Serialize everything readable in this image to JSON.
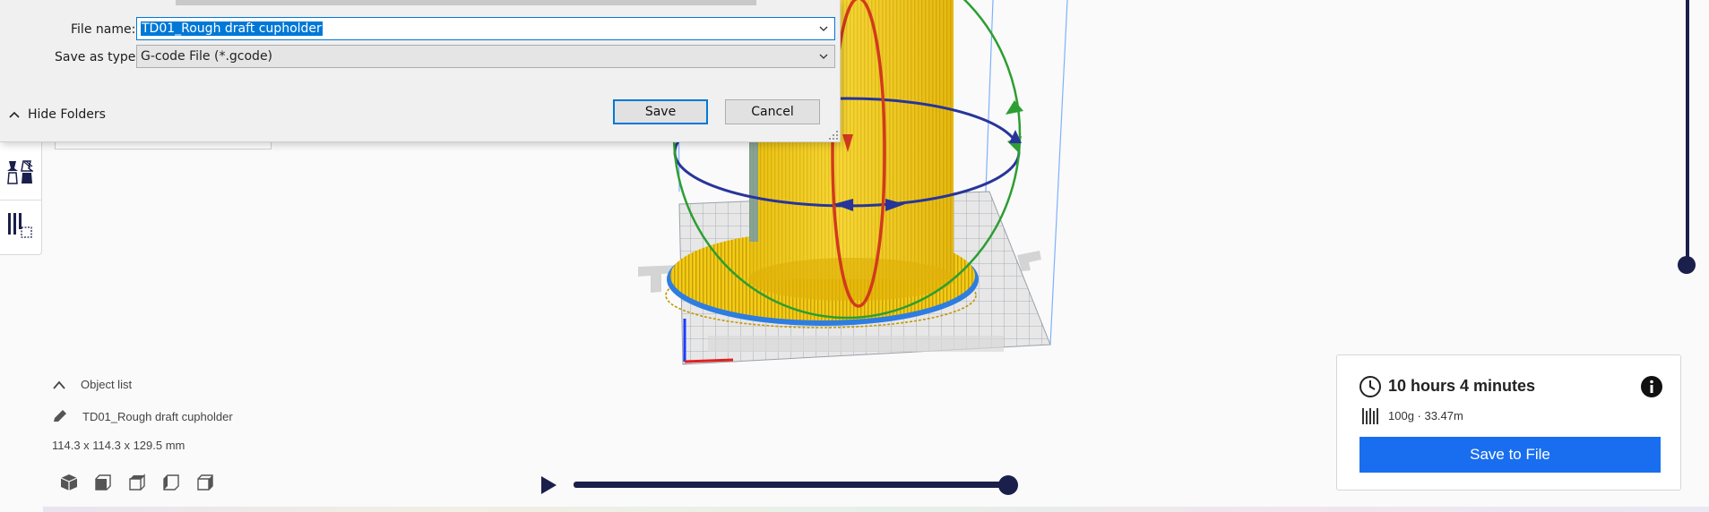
{
  "dialog": {
    "file_name_label": "File name:",
    "file_name_value": "TD01_Rough draft cupholder",
    "save_type_label": "Save as type:",
    "save_type_value": "G-code File (*.gcode)",
    "hide_folders_label": "Hide Folders",
    "save_label": "Save",
    "cancel_label": "Cancel"
  },
  "object_list": {
    "header_label": "Object list",
    "object_name": "TD01_Rough draft cupholder",
    "dimensions": "114.3 x 114.3 x 129.5 mm"
  },
  "print_info": {
    "time": "10 hours 4 minutes",
    "material": "100g · 33.47m",
    "save_button_label": "Save to File"
  },
  "colors": {
    "accent": "#196ef0",
    "slider": "#1a1f4b",
    "model": "#f6d21a",
    "selection": "#0078d7"
  },
  "icons": [
    "clock-icon",
    "info-icon",
    "filament-icon",
    "pencil-icon",
    "chevron-up-icon",
    "play-icon",
    "view-3d-icon",
    "view-front-icon",
    "view-top-icon",
    "view-left-icon",
    "view-right-icon",
    "support-blocker-icon",
    "per-model-settings-icon"
  ]
}
